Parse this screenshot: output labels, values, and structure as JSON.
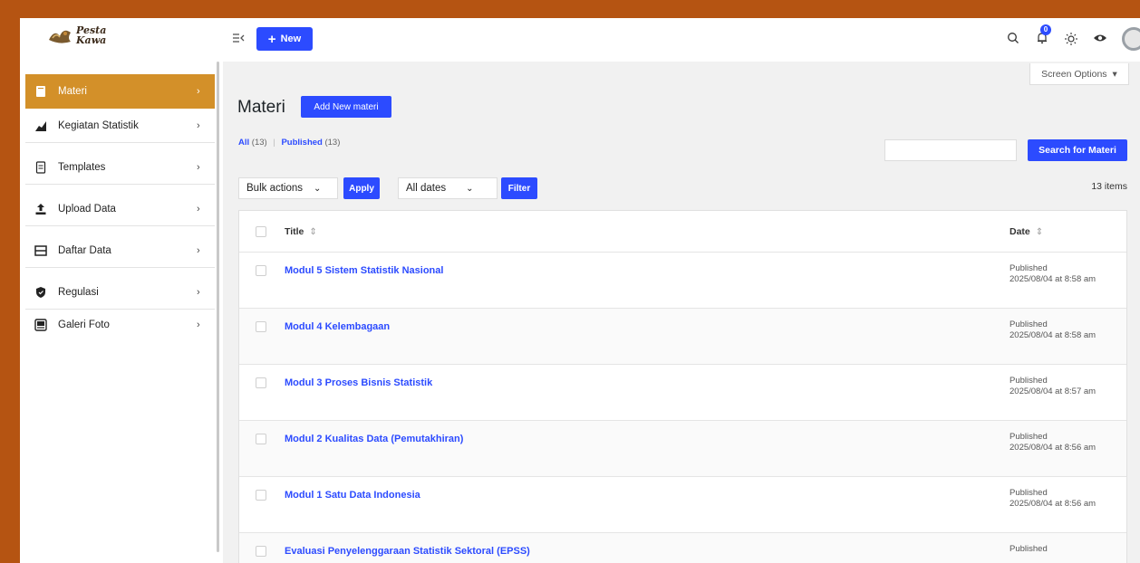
{
  "brand": {
    "name_line1": "Pesta",
    "name_line2": "Kawa"
  },
  "topbar": {
    "new_label": "New",
    "notification_count": "0",
    "icons": [
      "collapse-menu-icon",
      "plus-icon",
      "search-icon",
      "bell-icon",
      "sun-icon",
      "eye-icon",
      "avatar"
    ]
  },
  "sidebar": {
    "items": [
      {
        "label": "Materi",
        "icon": "book-icon",
        "active": true
      },
      {
        "label": "Kegiatan Statistik",
        "icon": "chart-area-icon",
        "active": false
      },
      {
        "label": "Templates",
        "icon": "document-icon",
        "active": false
      },
      {
        "label": "Upload Data",
        "icon": "upload-icon",
        "active": false
      },
      {
        "label": "Daftar Data",
        "icon": "table-icon",
        "active": false
      },
      {
        "label": "Regulasi",
        "icon": "shield-icon",
        "active": false
      },
      {
        "label": "Galeri Foto",
        "icon": "gallery-icon",
        "active": false
      }
    ]
  },
  "main": {
    "screen_options": "Screen Options",
    "title": "Materi",
    "add_new_label": "Add New materi",
    "filters": {
      "all_label": "All",
      "all_count": "(13)",
      "published_label": "Published",
      "published_count": "(13)"
    },
    "search_button": "Search for Materi",
    "search_value": "",
    "bulk_actions": "Bulk actions",
    "apply_label": "Apply",
    "dates_select": "All dates",
    "filter_label": "Filter",
    "items_count": "13 items",
    "table": {
      "col_title": "Title",
      "col_date": "Date",
      "rows": [
        {
          "title": "Modul 5 Sistem Statistik Nasional",
          "status": "Published",
          "date": "2025/08/04 at 8:58 am"
        },
        {
          "title": "Modul 4 Kelembagaan",
          "status": "Published",
          "date": "2025/08/04 at 8:58 am"
        },
        {
          "title": "Modul 3 Proses Bisnis Statistik",
          "status": "Published",
          "date": "2025/08/04 at 8:57 am"
        },
        {
          "title": "Modul 2 Kualitas Data (Pemutakhiran)",
          "status": "Published",
          "date": "2025/08/04 at 8:56 am"
        },
        {
          "title": "Modul 1 Satu Data Indonesia",
          "status": "Published",
          "date": "2025/08/04 at 8:56 am"
        },
        {
          "title": "Evaluasi Penyelenggaraan Statistik Sektoral (EPSS)",
          "status": "Published",
          "date": ""
        }
      ]
    }
  },
  "colors": {
    "background_frame": "#b55412",
    "accent": "#2c4bff",
    "sidebar_active": "#d39029"
  }
}
